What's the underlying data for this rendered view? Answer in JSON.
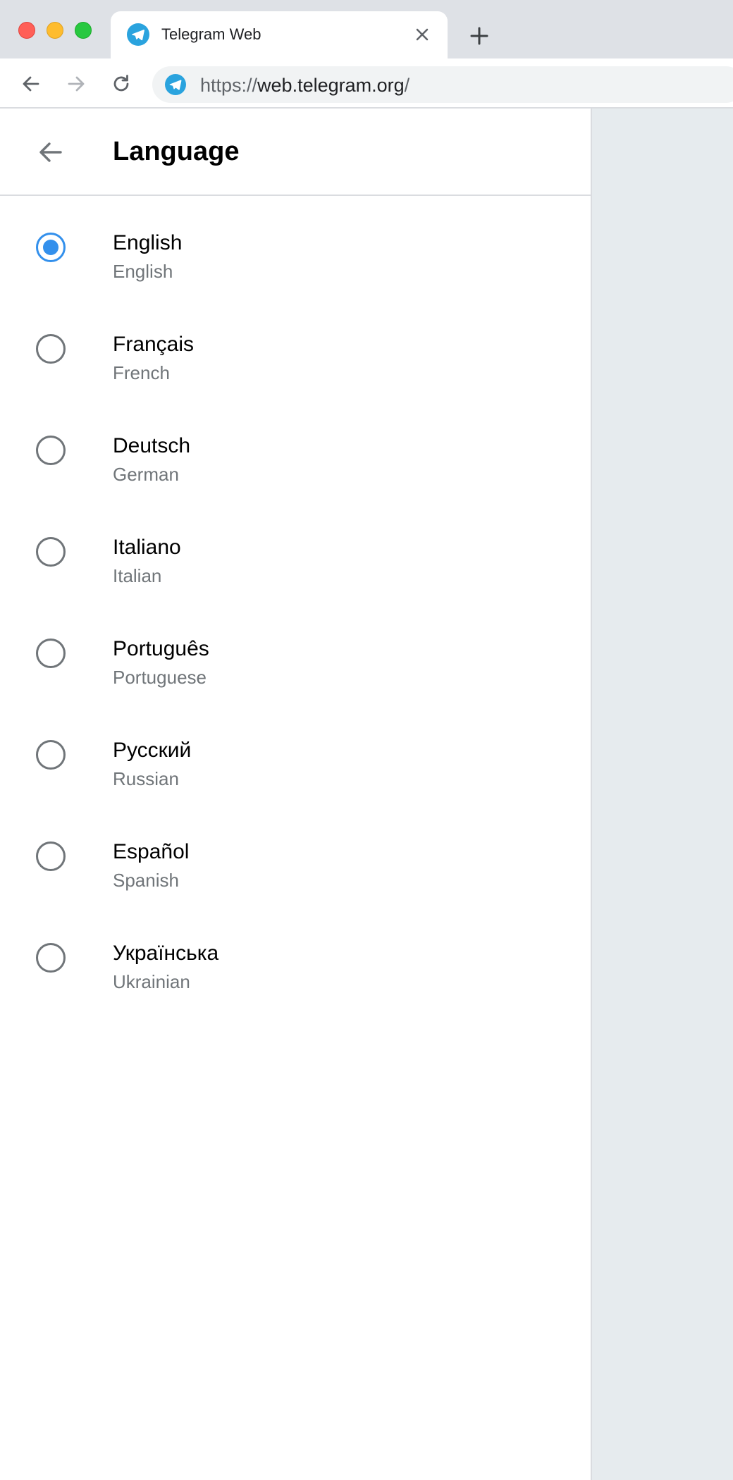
{
  "browser": {
    "tab": {
      "title": "Telegram Web",
      "favicon": "telegram-icon"
    },
    "address": {
      "scheme": "https://",
      "host": "web.telegram.org",
      "path": "/"
    }
  },
  "settings": {
    "header": {
      "title": "Language"
    },
    "languages": [
      {
        "name": "English",
        "english_name": "English",
        "selected": true
      },
      {
        "name": "Français",
        "english_name": "French",
        "selected": false
      },
      {
        "name": "Deutsch",
        "english_name": "German",
        "selected": false
      },
      {
        "name": "Italiano",
        "english_name": "Italian",
        "selected": false
      },
      {
        "name": "Português",
        "english_name": "Portuguese",
        "selected": false
      },
      {
        "name": "Русский",
        "english_name": "Russian",
        "selected": false
      },
      {
        "name": "Español",
        "english_name": "Spanish",
        "selected": false
      },
      {
        "name": "Українська",
        "english_name": "Ukrainian",
        "selected": false
      }
    ]
  },
  "colors": {
    "accent": "#3390ec",
    "telegram_brand": "#2aa3de",
    "secondary_text": "#707579",
    "chat_background": "#e6ebee"
  }
}
